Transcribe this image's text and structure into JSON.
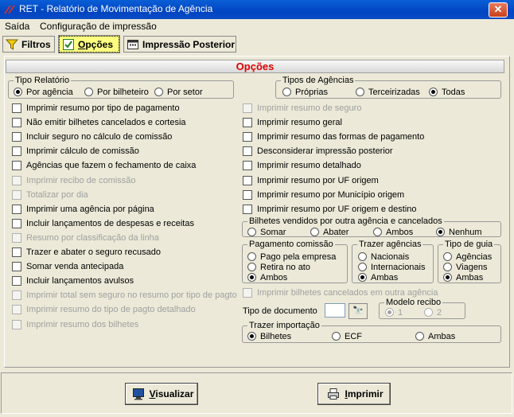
{
  "window": {
    "title": "RET - Relatório de Movimentação de Agência",
    "close_glyph": "✕"
  },
  "menu": {
    "items": [
      "Saída",
      "Configuração de impressão"
    ]
  },
  "toolbar": {
    "filtros": "Filtros",
    "opcoes": "Opções",
    "impressao": "Impressão Posterior"
  },
  "panel": {
    "title": "Opções"
  },
  "tipo_relatorio": {
    "legend": "Tipo Relatório",
    "options": [
      "Por agência",
      "Por bilheteiro",
      "Por setor"
    ],
    "selected": 0
  },
  "tipos_agencias": {
    "legend": "Tipos de Agências",
    "options": [
      "Próprias",
      "Terceirizadas",
      "Todas"
    ],
    "selected": 2
  },
  "left_checks": [
    {
      "label": "Imprimir resumo por tipo de pagamento",
      "enabled": true
    },
    {
      "label": "Não emitir bilhetes cancelados e cortesia",
      "enabled": true
    },
    {
      "label": "Incluir seguro no cálculo de comissão",
      "enabled": true
    },
    {
      "label": "Imprimir cálculo de comissão",
      "enabled": true
    },
    {
      "label": "Agências que fazem o fechamento de caixa",
      "enabled": true
    },
    {
      "label": "Imprimir recibo de comissão",
      "enabled": false
    },
    {
      "label": "Totalizar por dia",
      "enabled": false
    },
    {
      "label": "Imprimir uma agência por página",
      "enabled": true
    },
    {
      "label": "Incluir lançamentos de despesas e receitas",
      "enabled": true
    },
    {
      "label": "Resumo por classificação da linha",
      "enabled": false
    },
    {
      "label": "Trazer e abater o seguro recusado",
      "enabled": true
    },
    {
      "label": "Somar venda antecipada",
      "enabled": true
    },
    {
      "label": "Incluir lançamentos avulsos",
      "enabled": true
    },
    {
      "label": "Imprimir total sem seguro no resumo por tipo de pagto",
      "enabled": false
    },
    {
      "label": "Imprimir resumo do tipo de pagto detalhado",
      "enabled": false
    },
    {
      "label": "Imprimir resumo dos bilhetes",
      "enabled": false
    }
  ],
  "right_checks": [
    {
      "label": "Imprimir resumo de seguro",
      "enabled": false
    },
    {
      "label": "Imprimir resumo geral",
      "enabled": true
    },
    {
      "label": "Imprimir resumo das formas de pagamento",
      "enabled": true
    },
    {
      "label": "Desconsiderar impressão posterior",
      "enabled": true
    },
    {
      "label": "Imprimir resumo detalhado",
      "enabled": true
    },
    {
      "label": "Imprimir resumo por UF origem",
      "enabled": true
    },
    {
      "label": "Imprimir resumo por Município origem",
      "enabled": true
    },
    {
      "label": "Imprimir resumo por UF origem e destino",
      "enabled": true
    }
  ],
  "bilhetes_vendidos": {
    "legend": "Bilhetes vendidos por outra agência e cancelados",
    "options": [
      "Somar",
      "Abater",
      "Ambos",
      "Nenhum"
    ],
    "selected": 3
  },
  "pagamento_comissao": {
    "legend": "Pagamento comissão",
    "options": [
      "Pago pela empresa",
      "Retira no ato",
      "Ambos"
    ],
    "selected": 2
  },
  "trazer_agencias": {
    "legend": "Trazer agências",
    "options": [
      "Nacionais",
      "Internacionais",
      "Ambas"
    ],
    "selected": 2
  },
  "tipo_guia": {
    "legend": "Tipo de guia",
    "options": [
      "Agências",
      "Viagens",
      "Ambas"
    ],
    "selected": 2
  },
  "cancelados_check": {
    "label": "Imprimir bilhetes cancelados em outra agência"
  },
  "tipo_documento": {
    "label": "Tipo de documento",
    "value": "",
    "button_glyph": "🔭"
  },
  "modelo_recibo": {
    "legend": "Modelo recibo",
    "options": [
      "1",
      "2"
    ],
    "selected": 0
  },
  "trazer_importacao": {
    "legend": "Trazer importação",
    "options": [
      "Bilhetes",
      "ECF",
      "Ambas"
    ],
    "selected": 0
  },
  "footer": {
    "visualizar": "Visualizar",
    "imprimir": "Imprimir"
  },
  "colors": {
    "title_bar": "#0245c1",
    "panel_title": "#e00000",
    "active_tab": "#ffff80"
  }
}
